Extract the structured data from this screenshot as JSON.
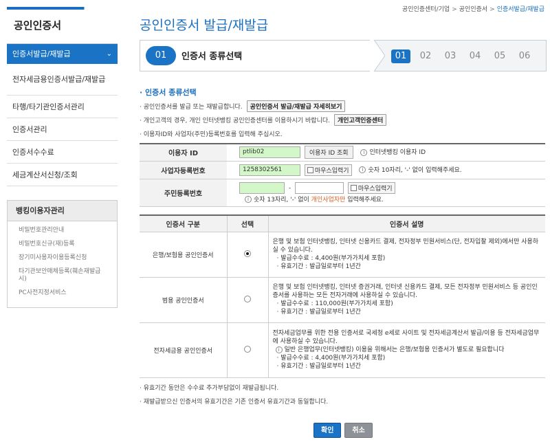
{
  "sidebar": {
    "title": "공인인증서",
    "menu": [
      {
        "label": "인증서발급/재발급",
        "active": true
      },
      {
        "label": "전자세금용인증서발급/재발급"
      },
      {
        "label": "타행/타기관인증서관리"
      },
      {
        "label": "인증서관리"
      },
      {
        "label": "인증서수수료"
      },
      {
        "label": "세금계산서신청/조회"
      }
    ],
    "sub_title": "뱅킹이용자관리",
    "sub_items": [
      "비밀번호관리안내",
      "비밀번호신규(재)등록",
      "장기미사용자이용등록신청",
      "타기관보안매체등록(훼손재발급시)",
      "PC사전지정서비스"
    ]
  },
  "breadcrumb": [
    "공인인증센터/기업",
    "공인인증서",
    "인증서발급/재발급"
  ],
  "page_title": "공인인증서 발급/재발급",
  "step": {
    "current_num": "01",
    "current_name": "인증서 종류선택",
    "nums": [
      "01",
      "02",
      "03",
      "04",
      "05",
      "06"
    ]
  },
  "section_title": "· 인증서 종류선택",
  "notes": [
    {
      "text": "· 공인인증서를 발급 또는 재발급합니다.",
      "button": "공인인증서 발급/재발급 자세히보기"
    },
    {
      "text": "· 개인고객의 경우, 개인 인터넷뱅킹 공인인증센터를 이용하시기 바랍니다.",
      "button": "개인고객인증센터"
    },
    {
      "text": "· 이용자ID와 사업자(주민)등록번호를 입력해 주십시오."
    }
  ],
  "form": {
    "user_id_label": "이용자 ID",
    "user_id_value": "ptlib02",
    "user_id_btn": "이용자 ID 조회",
    "user_id_info": "인터넷뱅킹 이용자 ID",
    "biz_label": "사업자등록번호",
    "biz_value": "1258302561",
    "mouse_input": "마우스입력기",
    "biz_info": "숫자 10자리, '-' 없이 입력해주세요.",
    "rrn_label": "주민등록번호",
    "rrn_dash": "-",
    "rrn_info_pre": "숫자 13자리, '-' 없이",
    "rrn_info_hl": "개인사업자만",
    "rrn_info_post": "입력해주세요."
  },
  "cert_table": {
    "headers": [
      "인증서 구분",
      "선택",
      "인증서 설명"
    ],
    "rows": [
      {
        "name": "은행/보험용 공인인증서",
        "selected": true,
        "desc": "은행 및 보험 인터넷뱅킹, 인터넷 신용카드 결제, 전자정부 민원서비스(단, 전자입찰 제외)에서만 사용하실 수 있습니다.",
        "fee": "· 발급수수료 : 4,400원(부가가치세 포함)",
        "period": "· 유효기간 : 발급일로부터 1년간"
      },
      {
        "name": "범용 공인인증서",
        "selected": false,
        "desc": "은행 및 보험 인터넷뱅킹, 인터넷 증권거래, 인터넷 신용카드 결제, 모든 전자정부 민원서비스 등 공인인증서를 사용하는 모든 전자거래에 사용하실 수 있습니다.",
        "fee": "· 발급수수료 : 110,000원(부가가치세 포함)",
        "period": "· 유효기간 : 발급일로부터 1년간"
      },
      {
        "name": "전자세금용 공인인증서",
        "selected": false,
        "desc": "전자세금업무를 위한 전용 인증서로 국세청 e세로 사이트 및 전자세금계산서 발급/이용 등 전자세금업무에 사용하실 수 있습니다.",
        "notice": "일반 은행업무(인터넷뱅킹) 이용을 위해서는 은행/보험용 인증서가 별도로 필요합니다",
        "fee": "· 발급수수료 : 4,400원(부가가치세 포함)",
        "period": "· 유효기간 : 발급일로부터 1년간"
      }
    ]
  },
  "footer_notes": [
    "· 유효기간 동안은 수수료 추가부담없이 재발급됩니다.",
    "· 재발급받으신 인증서의 유효기간은 기존 인증서 유효기간과 동일합니다."
  ],
  "buttons": {
    "ok": "확인",
    "cancel": "취소"
  },
  "colors": {
    "accent": "#1a73c5",
    "input_green": "#d3f7c8",
    "highlight": "#e05a20"
  }
}
